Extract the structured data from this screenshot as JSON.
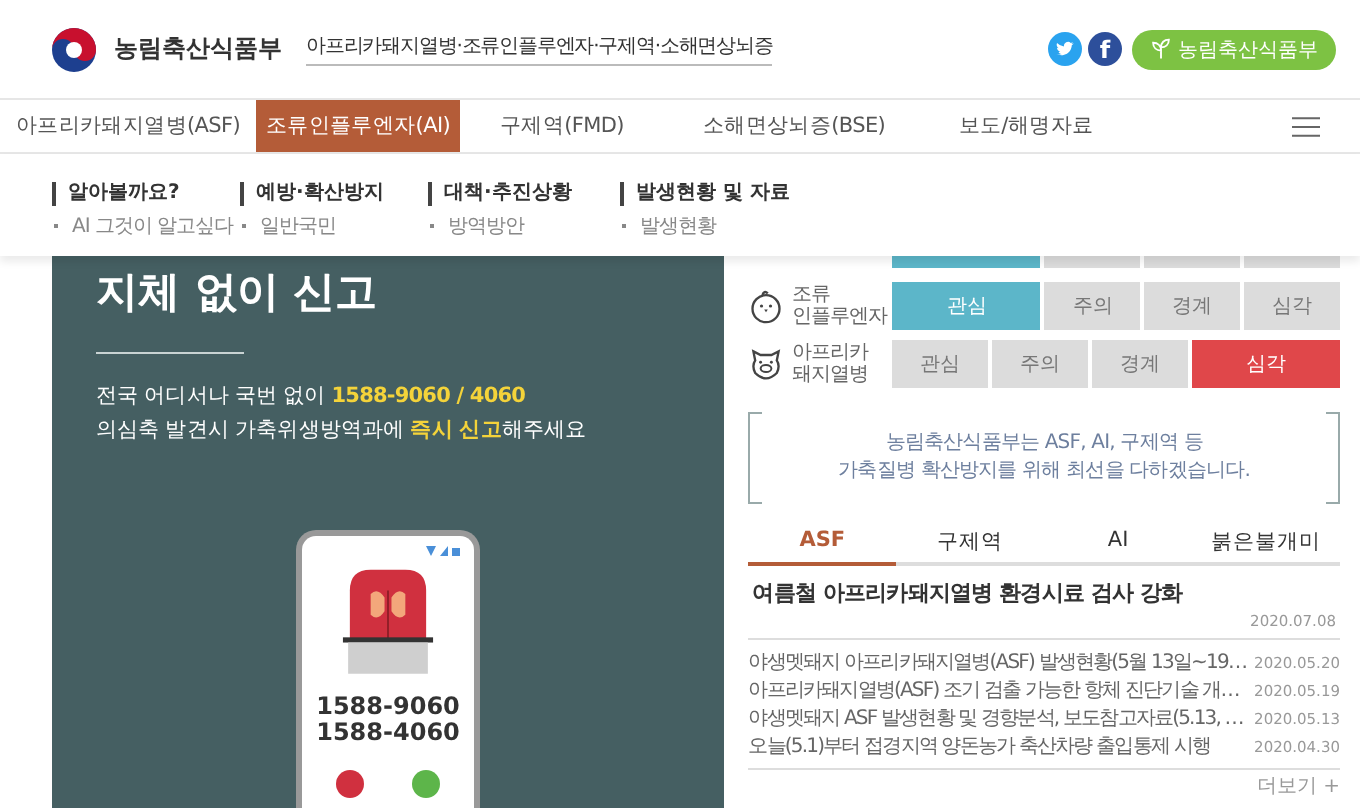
{
  "header": {
    "ministry_name": "농림축산식품부",
    "tagline": "아프리카돼지열병·조류인플루엔자·구제역·소해면상뇌증",
    "facebook_letter": "f",
    "ministry_button": "농림축산식품부"
  },
  "nav": {
    "tabs": [
      {
        "label": "아프리카돼지열병(ASF)",
        "selected": false
      },
      {
        "label": "조류인플루엔자(AI)",
        "selected": true
      },
      {
        "label": "구제역(FMD)",
        "selected": false
      },
      {
        "label": "소해면상뇌증(BSE)",
        "selected": false
      },
      {
        "label": "보도/해명자료",
        "selected": false
      }
    ]
  },
  "dropdown": [
    {
      "title": "알아볼까요?",
      "items": [
        "AI 그것이 알고싶다"
      ]
    },
    {
      "title": "예방·확산방지",
      "items": [
        "일반국민"
      ]
    },
    {
      "title": "대책·추진상황",
      "items": [
        "방역방안"
      ]
    },
    {
      "title": "발생현황 및 자료",
      "items": [
        "발생현황"
      ]
    }
  ],
  "banner": {
    "heading": "지체 없이 신고",
    "lines": [
      [
        {
          "text": "전국 어디서나 국번 없이 ",
          "highlight": false
        },
        {
          "text": "1588-9060 / 4060",
          "highlight": true
        }
      ],
      [
        {
          "text": "의심축 발견시 가축위생방역과에 ",
          "highlight": false
        },
        {
          "text": "즉시 신고",
          "highlight": true
        },
        {
          "text": "해주세요",
          "highlight": false
        }
      ]
    ],
    "phone_numbers": [
      "1588-9060",
      "1588-4060"
    ]
  },
  "status_table": {
    "rows": [
      {
        "kind": "partial",
        "cells": [
          {
            "selected": true
          },
          {
            "selected": false
          },
          {
            "selected": false
          },
          {
            "selected": false
          }
        ]
      },
      {
        "kind": "bird",
        "name": "조류\n인플루엔자",
        "cells": [
          {
            "label": "관심",
            "selected": true
          },
          {
            "label": "주의",
            "selected": false
          },
          {
            "label": "경계",
            "selected": false
          },
          {
            "label": "심각",
            "selected": false
          }
        ]
      },
      {
        "kind": "pig",
        "name": "아프리카\n돼지열병",
        "cells": [
          {
            "label": "관심",
            "selected": false
          },
          {
            "label": "주의",
            "selected": false
          },
          {
            "label": "경계",
            "selected": false
          },
          {
            "label": "심각",
            "selected": true
          }
        ]
      }
    ]
  },
  "message": [
    "농림축산식품부는 ASF, AI, 구제역 등",
    "가축질병 확산방지를 위해 최선을 다하겠습니다."
  ],
  "news": {
    "tabs": [
      {
        "label": "ASF",
        "selected": true
      },
      {
        "label": "구제역",
        "selected": false
      },
      {
        "label": "AI",
        "selected": false
      },
      {
        "label": "붉은불개미",
        "selected": false
      }
    ],
    "headline": {
      "title": "여름철 아프리카돼지열병 환경시료 검사 강화",
      "date": "2020.07.08"
    },
    "items": [
      {
        "title": "야생멧돼지 아프리카돼지열병(ASF) 발생현황(5월 13일~19…",
        "date": "2020.05.20"
      },
      {
        "title": "아프리카돼지열병(ASF) 조기 검출 가능한 항체 진단기술 개…",
        "date": "2020.05.19"
      },
      {
        "title": "야생멧돼지 ASF 발생현황 및 경향분석, 보도참고자료(5.13, …",
        "date": "2020.05.13"
      },
      {
        "title": "오늘(5.1)부터 접경지역 양돈농가 축산차량 출입통제 시행",
        "date": "2020.04.30"
      }
    ],
    "more": "더보기",
    "more_icon": "+"
  }
}
